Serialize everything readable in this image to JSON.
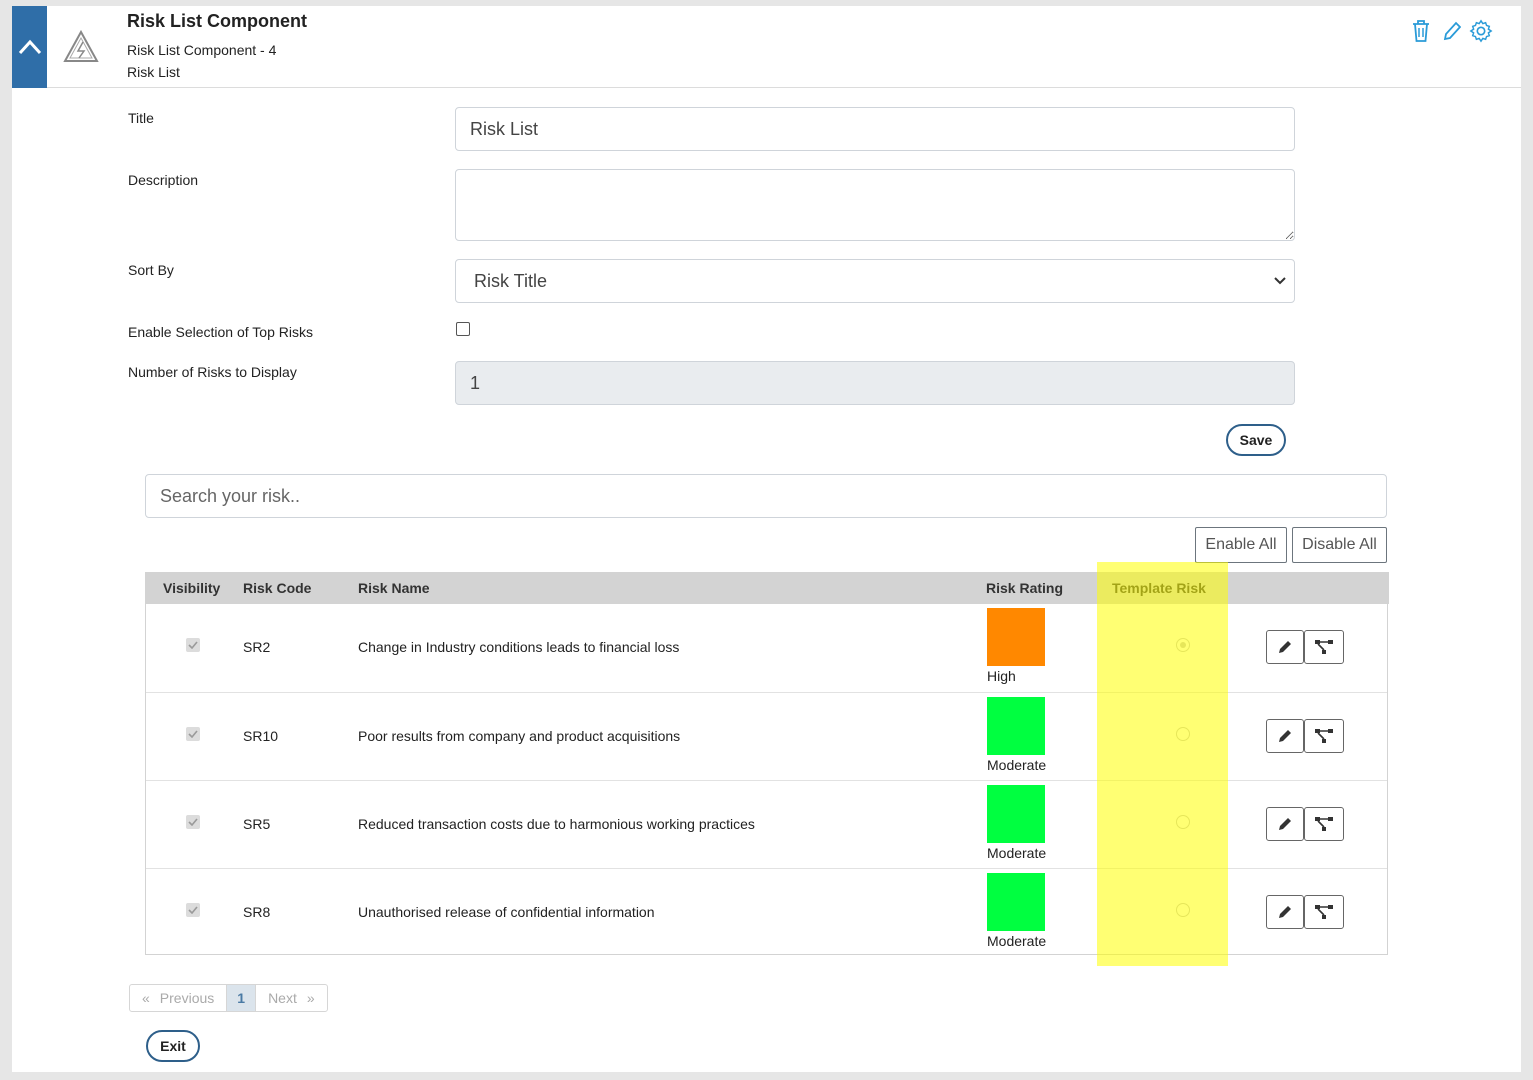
{
  "header": {
    "title": "Risk List Component",
    "subtitle": "Risk List Component - 4",
    "subtitle2": "Risk List"
  },
  "form": {
    "title_label": "Title",
    "title_value": "Risk List",
    "description_label": "Description",
    "description_value": "",
    "sort_label": "Sort By",
    "sort_value": "Risk Title",
    "enable_top_label": "Enable Selection of Top Risks",
    "enable_top_checked": false,
    "num_risks_label": "Number of Risks to Display",
    "num_risks_value": "1",
    "save_label": "Save"
  },
  "search": {
    "placeholder": "Search your risk.."
  },
  "toolbar": {
    "enable_all": "Enable All",
    "disable_all": "Disable All"
  },
  "table": {
    "headers": {
      "visibility": "Visibility",
      "risk_code": "Risk Code",
      "risk_name": "Risk Name",
      "risk_rating": "Risk Rating",
      "template_risk": "Template Risk"
    },
    "rows": [
      {
        "code": "SR2",
        "name": "Change in Industry conditions leads to financial loss",
        "rating": "High",
        "color": "#ff8800",
        "template": true
      },
      {
        "code": "SR10",
        "name": "Poor results from company and product acquisitions",
        "rating": "Moderate",
        "color": "#00ff40",
        "template": false
      },
      {
        "code": "SR5",
        "name": "Reduced transaction costs due to harmonious working practices",
        "rating": "Moderate",
        "color": "#00ff40",
        "template": false
      },
      {
        "code": "SR8",
        "name": "Unauthorised release of confidential information",
        "rating": "Moderate",
        "color": "#00ff40",
        "template": false
      }
    ]
  },
  "pagination": {
    "previous": "Previous",
    "page": "1",
    "next": "Next",
    "prev_arrow": "«",
    "next_arrow": "»"
  },
  "footer": {
    "exit_label": "Exit"
  },
  "colors": {
    "accent": "#2f6ea8",
    "highlight": "#ffff00",
    "high": "#ff8800",
    "moderate": "#00ff40"
  }
}
